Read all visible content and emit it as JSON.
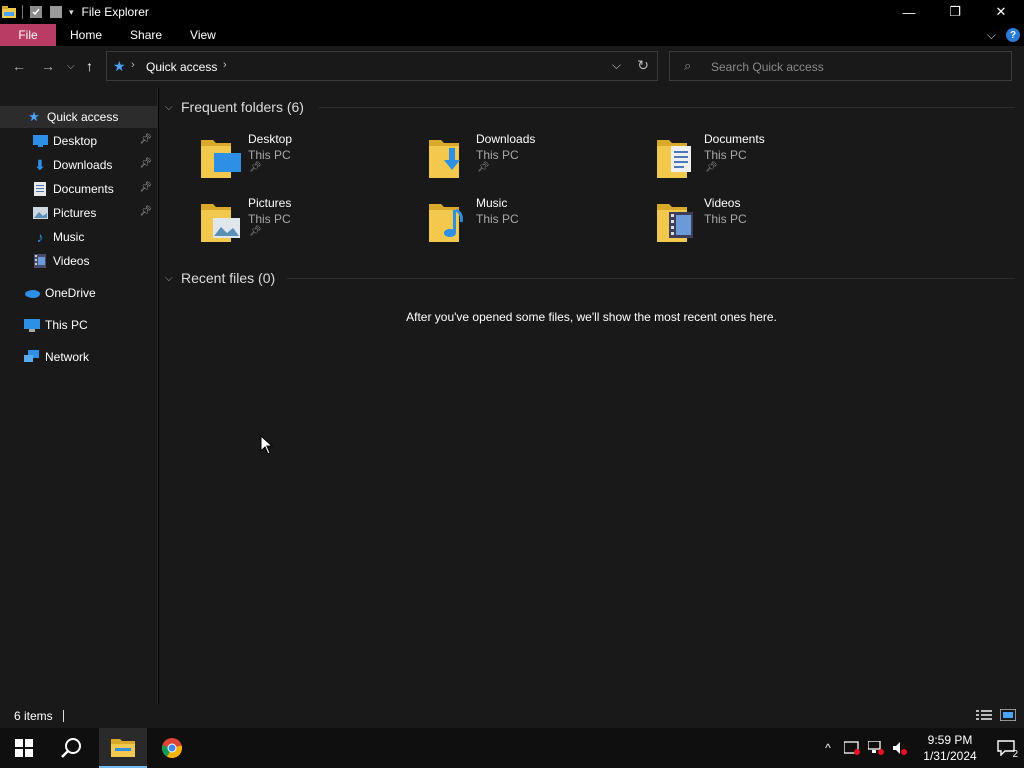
{
  "window": {
    "title": "File Explorer"
  },
  "ribbon": {
    "tabs": [
      "File",
      "Home",
      "Share",
      "View"
    ]
  },
  "address": {
    "crumb": "Quick access"
  },
  "search": {
    "placeholder": "Search Quick access"
  },
  "sidebar": {
    "items": [
      {
        "label": "Quick access",
        "icon": "star-icon"
      },
      {
        "label": "Desktop",
        "icon": "desktop-icon",
        "pinned": true
      },
      {
        "label": "Downloads",
        "icon": "download-icon",
        "pinned": true
      },
      {
        "label": "Documents",
        "icon": "documents-icon",
        "pinned": true
      },
      {
        "label": "Pictures",
        "icon": "pictures-icon",
        "pinned": true
      },
      {
        "label": "Music",
        "icon": "music-icon"
      },
      {
        "label": "Videos",
        "icon": "videos-icon"
      },
      {
        "label": "OneDrive",
        "icon": "cloud-icon"
      },
      {
        "label": "This PC",
        "icon": "computer-icon"
      },
      {
        "label": "Network",
        "icon": "network-icon"
      }
    ]
  },
  "main": {
    "frequent_header": "Frequent folders (6)",
    "recent_header": "Recent files (0)",
    "empty_message": "After you've opened some files, we'll show the most recent ones here.",
    "folders": [
      {
        "name": "Desktop",
        "location": "This PC",
        "pinned": true
      },
      {
        "name": "Downloads",
        "location": "This PC",
        "pinned": true
      },
      {
        "name": "Documents",
        "location": "This PC",
        "pinned": true
      },
      {
        "name": "Pictures",
        "location": "This PC",
        "pinned": true
      },
      {
        "name": "Music",
        "location": "This PC",
        "pinned": false
      },
      {
        "name": "Videos",
        "location": "This PC",
        "pinned": false
      }
    ]
  },
  "status": {
    "item_count": "6 items"
  },
  "taskbar": {
    "time": "9:59 PM",
    "date": "1/31/2024",
    "notification_count": "2"
  },
  "colors": {
    "file_tab": "#b83c63",
    "accent_blue": "#4aa3ff",
    "folder_yellow": "#f2c94c"
  }
}
